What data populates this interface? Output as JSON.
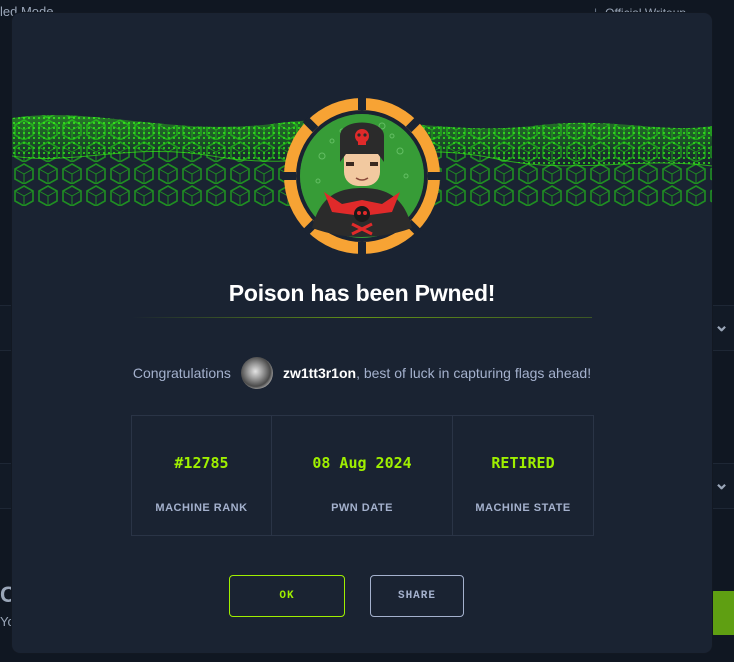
{
  "background": {
    "top_left_text": "led Mode",
    "top_right_text": "Official Writeup",
    "bottom_left_text": "C",
    "bottom_left_sub": "Yo"
  },
  "modal": {
    "title": "Poison has been Pwned!",
    "congrats_prefix": "Congratulations",
    "username": "zw1tt3r1on",
    "congrats_suffix": ", best of luck in capturing flags ahead!",
    "stats": [
      {
        "value": "#12785",
        "label": "MACHINE RANK"
      },
      {
        "value": "08 Aug 2024",
        "label": "PWN DATE"
      },
      {
        "value": "RETIRED",
        "label": "MACHINE STATE"
      }
    ],
    "ok_label": "OK",
    "share_label": "SHARE"
  },
  "colors": {
    "accent": "#9fef00",
    "modal_bg": "#1a2332",
    "text_muted": "#a4b1cd",
    "avatar_ring": "#f7a334"
  },
  "icons": {
    "avatar": "hooded-hacker-with-skull-avatar",
    "chevron": "chevron-down-icon"
  }
}
